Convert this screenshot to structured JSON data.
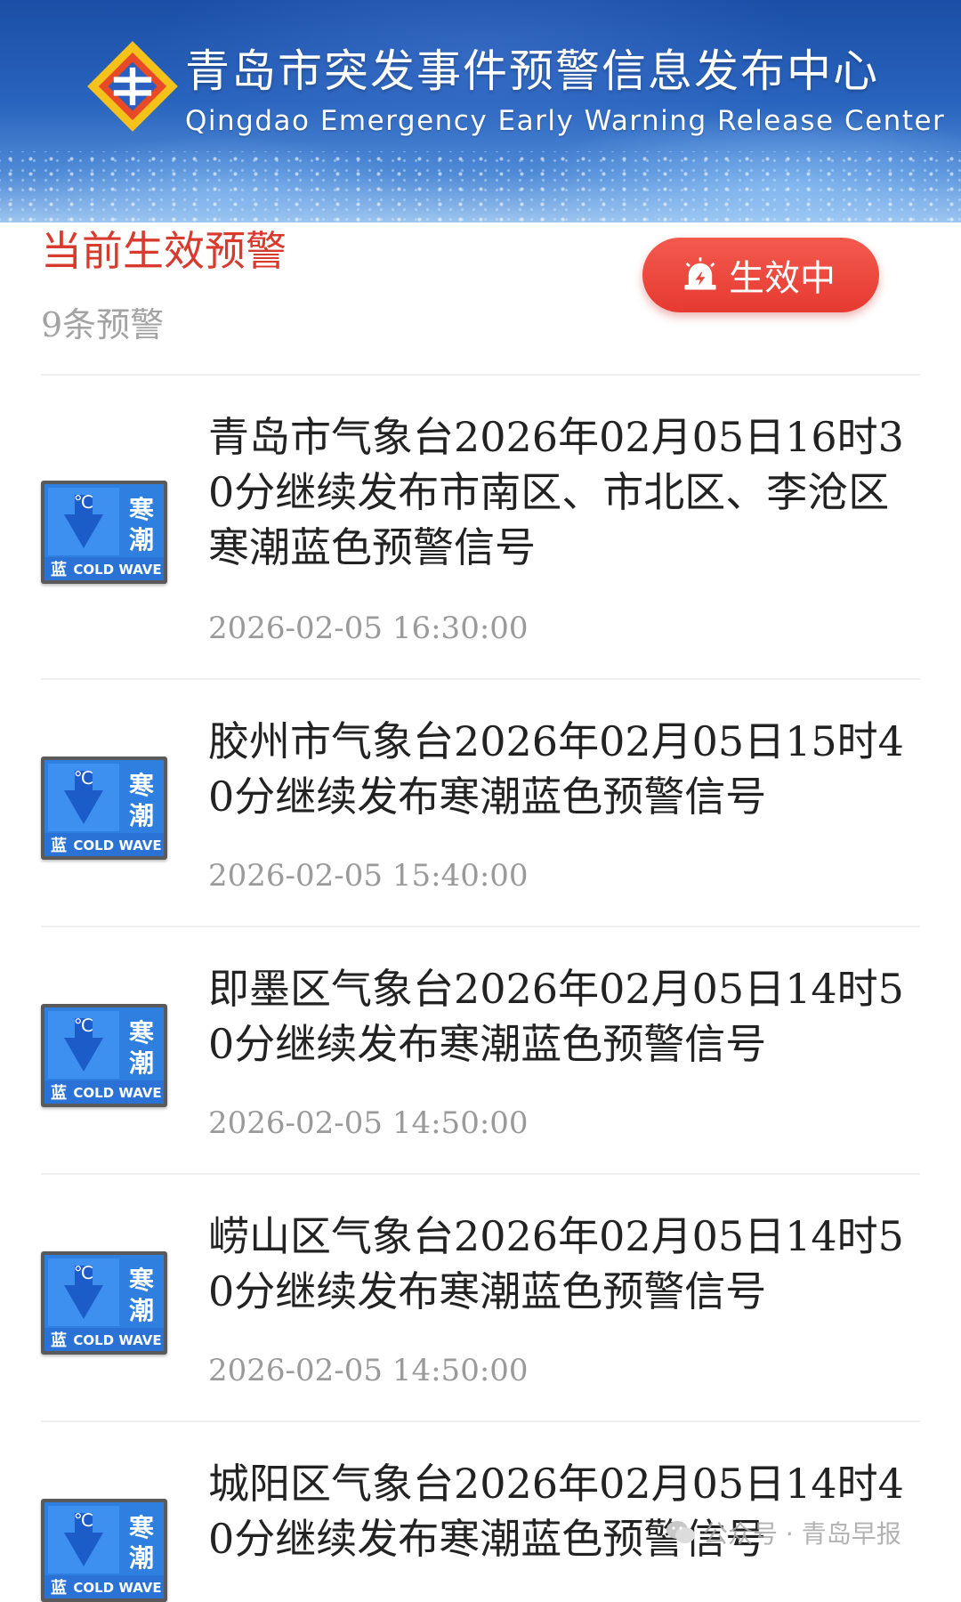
{
  "header": {
    "title": "青岛市突发事件预警信息发布中心",
    "subtitle": "Qingdao Emergency Early Warning Release Center"
  },
  "section": {
    "title": "当前生效预警",
    "count_label": "9条预警",
    "status_button": "生效中",
    "status_icon": "alarm-icon"
  },
  "signal_badge": {
    "text_cn": "寒潮",
    "level_cn": "蓝",
    "text_en": "COLD WAVE",
    "unit": "℃",
    "icon": "cold-wave-blue-icon",
    "color": "#2f7fe0"
  },
  "warnings": [
    {
      "title": "青岛市气象台2026年02月05日16时30分继续发布市南区、市北区、李沧区寒潮蓝色预警信号",
      "time": "2026-02-05 16:30:00"
    },
    {
      "title": "胶州市气象台2026年02月05日15时40分继续发布寒潮蓝色预警信号",
      "time": "2026-02-05 15:40:00"
    },
    {
      "title": "即墨区气象台2026年02月05日14时50分继续发布寒潮蓝色预警信号",
      "time": "2026-02-05 14:50:00"
    },
    {
      "title": "崂山区气象台2026年02月05日14时50分继续发布寒潮蓝色预警信号",
      "time": "2026-02-05 14:50:00"
    },
    {
      "title": "城阳区气象台2026年02月05日14时40分继续发布寒潮蓝色预警信号",
      "time": ""
    }
  ],
  "watermark": "公众号 · 青岛早报",
  "colors": {
    "accent_red": "#d83a2e",
    "button_red": "#e8453a",
    "banner_blue": "#2863bd"
  }
}
